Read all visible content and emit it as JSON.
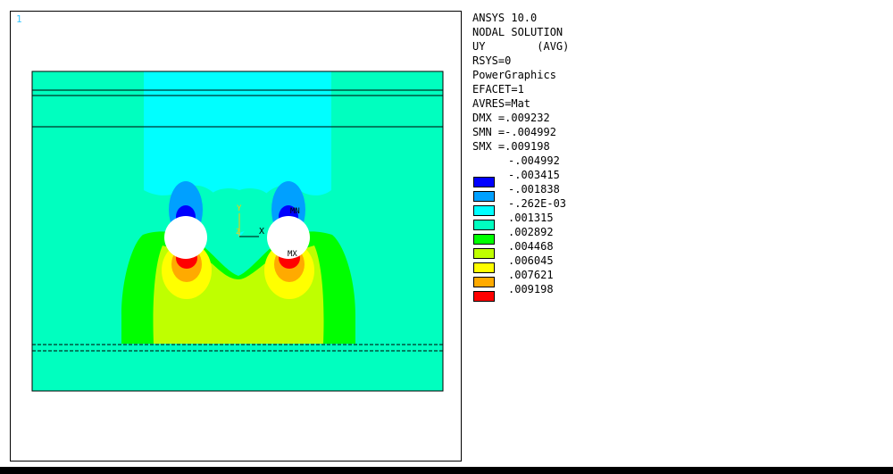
{
  "window_number": "1",
  "info_lines": [
    "ANSYS 10.0",
    "NODAL SOLUTION",
    "UY        (AVG)",
    "RSYS=0",
    "PowerGraphics",
    "EFACET=1",
    "AVRES=Mat",
    "DMX =.009232",
    "SMN =-.004992",
    "SMX =.009198"
  ],
  "legend": [
    {
      "value": "-.004992",
      "color": "",
      "show_swatch": false
    },
    {
      "value": "-.003415",
      "color": "#0000ff"
    },
    {
      "value": "-.001838",
      "color": "#00a0ff"
    },
    {
      "value": "-.262E-03",
      "color": "#00ffff"
    },
    {
      "value": ".001315",
      "color": "#00ffbf"
    },
    {
      "value": ".002892",
      "color": "#00ff00"
    },
    {
      "value": ".004468",
      "color": "#bfff00"
    },
    {
      "value": ".006045",
      "color": "#ffff00"
    },
    {
      "value": ".007621",
      "color": "#ffaa00"
    },
    {
      "value": ".009198",
      "color": "#ff0000"
    }
  ],
  "triad": {
    "x_label": "X",
    "y_label": "Y",
    "z_label": "Z"
  },
  "markers": {
    "min_label": "MN",
    "max_label": "MX"
  }
}
